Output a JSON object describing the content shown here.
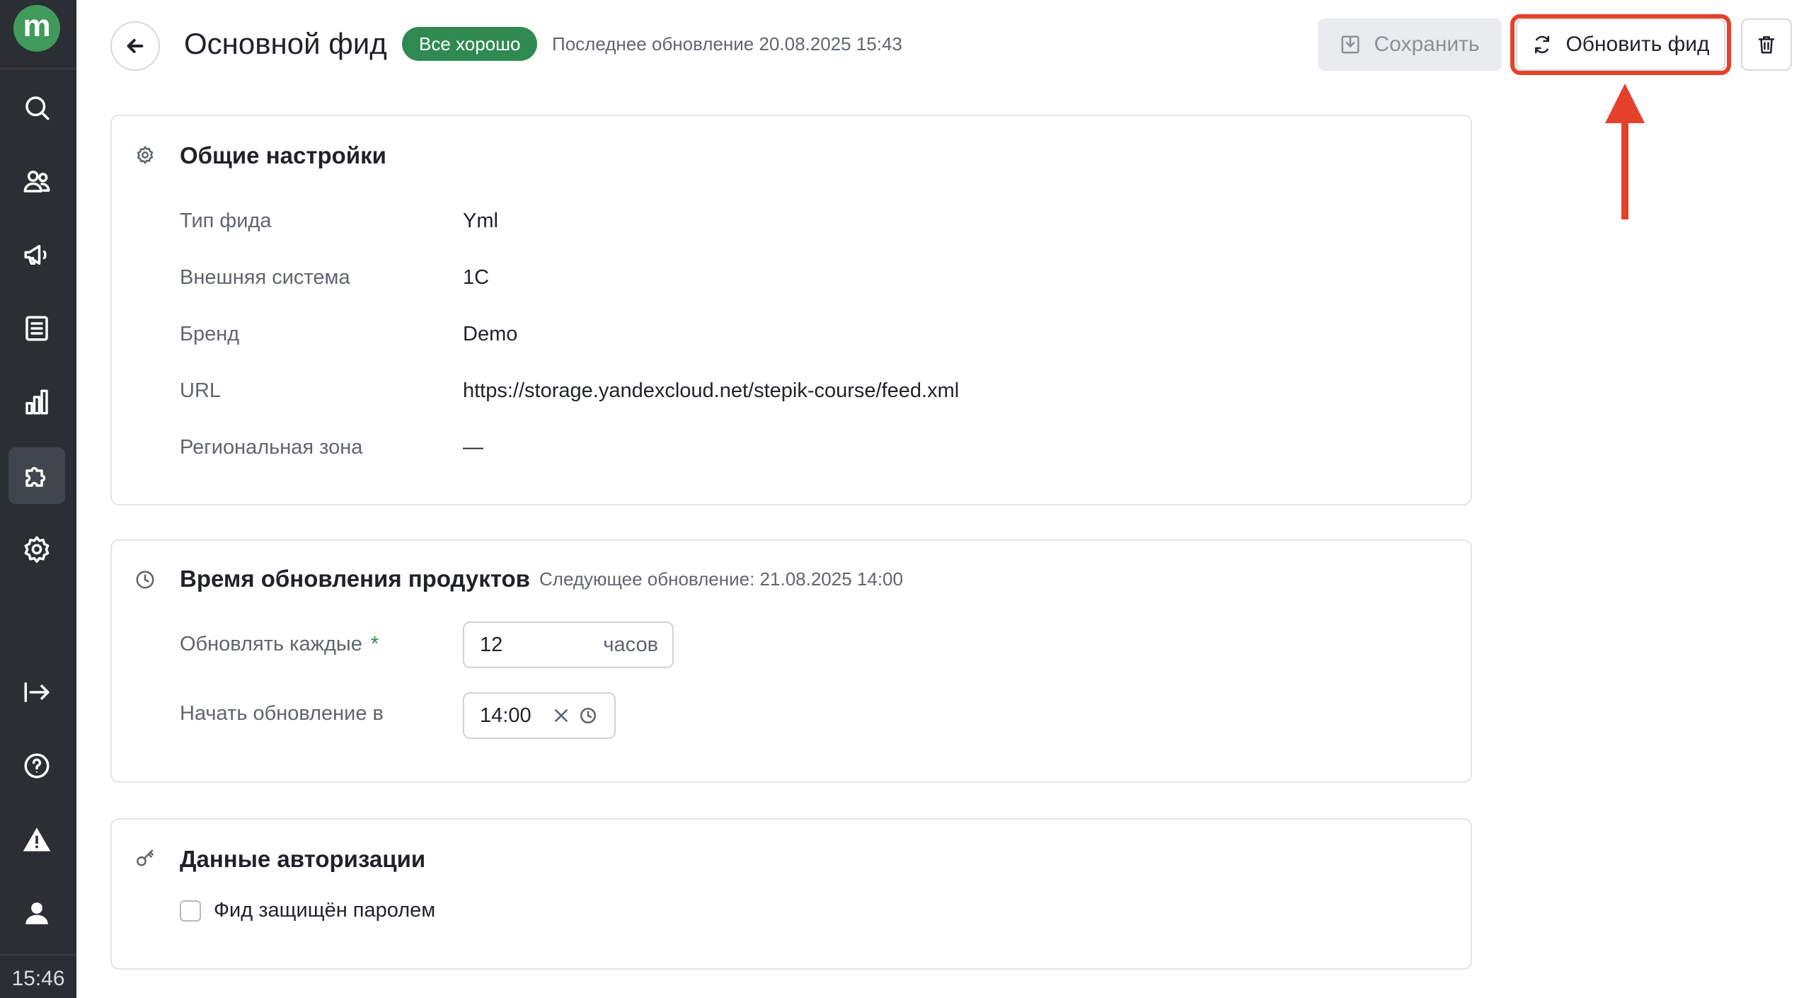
{
  "sidebar": {
    "logo_letter": "m",
    "time": "15:46",
    "icons": [
      "search-icon",
      "users-icon",
      "megaphone-icon",
      "list-icon",
      "bar-chart-icon",
      "puzzle-icon",
      "gear-icon",
      "logout-icon",
      "help-icon",
      "warning-icon",
      "user-icon"
    ],
    "active_item": "puzzle-icon"
  },
  "header": {
    "title": "Основной фид",
    "status_badge": "Все хорошо",
    "last_update": "Последнее обновление 20.08.2025 15:43",
    "save_label": "Сохранить",
    "refresh_label": "Обновить фид"
  },
  "general": {
    "title": "Общие настройки",
    "rows": [
      {
        "label": "Тип фида",
        "value": "Yml"
      },
      {
        "label": "Внешняя система",
        "value": "1С"
      },
      {
        "label": "Бренд",
        "value": "Demo"
      },
      {
        "label": "URL",
        "value": "https://storage.yandexcloud.net/stepik-course/feed.xml"
      },
      {
        "label": "Региональная зона",
        "value": "—"
      }
    ]
  },
  "schedule": {
    "title": "Время обновления продуктов",
    "next_update": "Следующее обновление: 21.08.2025 14:00",
    "interval_label": "Обновлять каждые",
    "required_mark": "*",
    "interval_value": "12",
    "interval_unit": "часов",
    "start_label": "Начать обновление в",
    "start_value": "14:00"
  },
  "auth": {
    "title": "Данные авторизации",
    "password_checkbox_label": "Фид защищён паролем",
    "password_checked": false
  },
  "colors": {
    "status_green": "#2f8a52",
    "highlight_red": "#e5402a",
    "sidebar_bg": "#2b2e33"
  }
}
